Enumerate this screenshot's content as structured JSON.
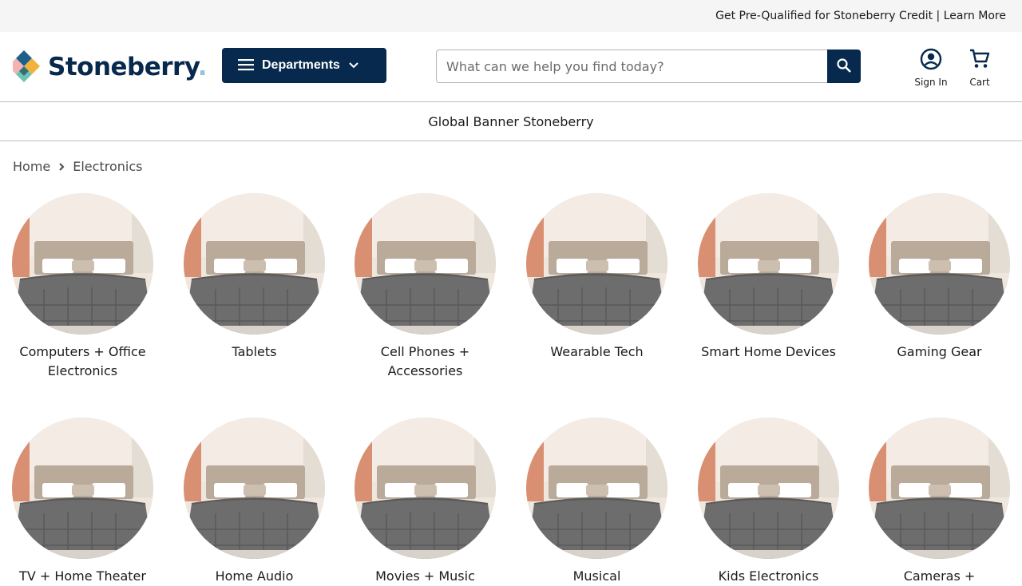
{
  "promo": {
    "text": "Get Pre-Qualified for Stoneberry Credit | Learn More"
  },
  "header": {
    "logo_text": "Stoneberry",
    "departments_label": "Departments",
    "search_placeholder": "What can we help you find today?",
    "sign_in_label": "Sign In",
    "cart_label": "Cart"
  },
  "global_banner": {
    "text": "Global Banner Stoneberry"
  },
  "breadcrumb": {
    "home": "Home",
    "current": "Electronics"
  },
  "categories": [
    {
      "label": "Computers + Office Electronics"
    },
    {
      "label": "Tablets"
    },
    {
      "label": "Cell Phones + Accessories"
    },
    {
      "label": "Wearable Tech"
    },
    {
      "label": "Smart Home Devices"
    },
    {
      "label": "Gaming Gear"
    },
    {
      "label": "TV + Home Theater"
    },
    {
      "label": "Home Audio"
    },
    {
      "label": "Movies + Music"
    },
    {
      "label": "Musical"
    },
    {
      "label": "Kids Electronics"
    },
    {
      "label": "Cameras +"
    }
  ],
  "colors": {
    "brand_navy": "#06294d",
    "promo_bg": "#f5f5f5",
    "logo_gold": "#f2b33d",
    "logo_teal": "#6cc4b4",
    "logo_pink": "#f3b3b3"
  },
  "icons": {
    "menu": "hamburger-icon",
    "departments_chevron": "chevron-down-icon",
    "search": "search-icon",
    "account": "account-circle-icon",
    "cart": "cart-icon",
    "breadcrumb_sep": "chevron-right-icon"
  }
}
